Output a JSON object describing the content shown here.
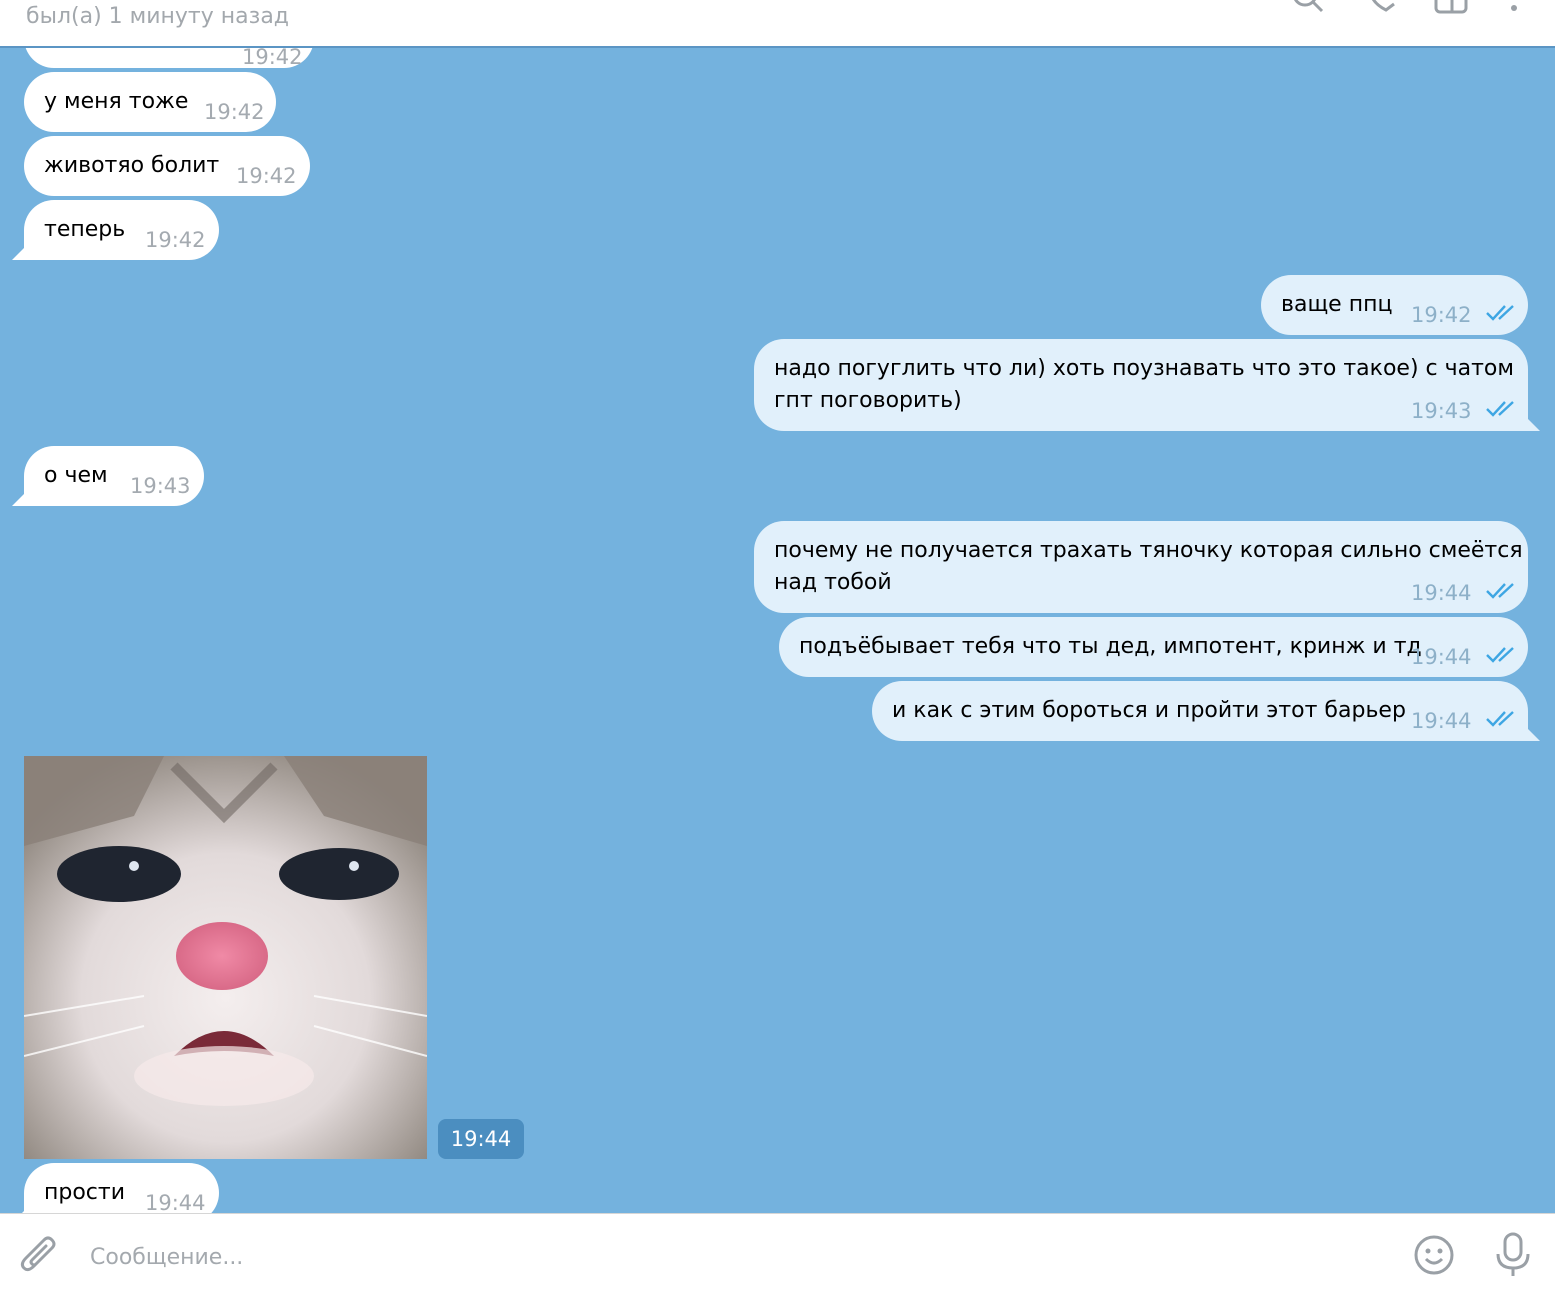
{
  "header": {
    "status": "был(а) 1 минуту назад"
  },
  "messages": [
    {
      "text": "",
      "time": "19:42"
    },
    {
      "text": "у меня тоже",
      "time": "19:42"
    },
    {
      "text": "животяо болит",
      "time": "19:42"
    },
    {
      "text": "теперь",
      "time": "19:42"
    },
    {
      "text": "ваще ппц",
      "time": "19:42"
    },
    {
      "line1": "надо погуглить что ли) хоть поузнавать что это такое) с чатом",
      "line2": "гпт поговорить)",
      "time": "19:43"
    },
    {
      "text": "о чем",
      "time": "19:43"
    },
    {
      "line1": "почему не получается трахать тяночку которая сильно смеётся",
      "line2": "над тобой",
      "time": "19:44"
    },
    {
      "text": "подъёбывает тебя что ты дед, импотент, кринж и тд",
      "time": "19:44"
    },
    {
      "text": "и как с этим бороться и пройти этот барьер",
      "time": "19:44"
    },
    {
      "time": "19:44"
    },
    {
      "text": "прости",
      "time": "19:44"
    }
  ],
  "composer": {
    "placeholder": "Сообщение..."
  },
  "colors": {
    "chat_bg": "#74b2de",
    "incoming": "#ffffff",
    "outgoing": "#e1f0fb",
    "check": "#3ea6e3"
  }
}
